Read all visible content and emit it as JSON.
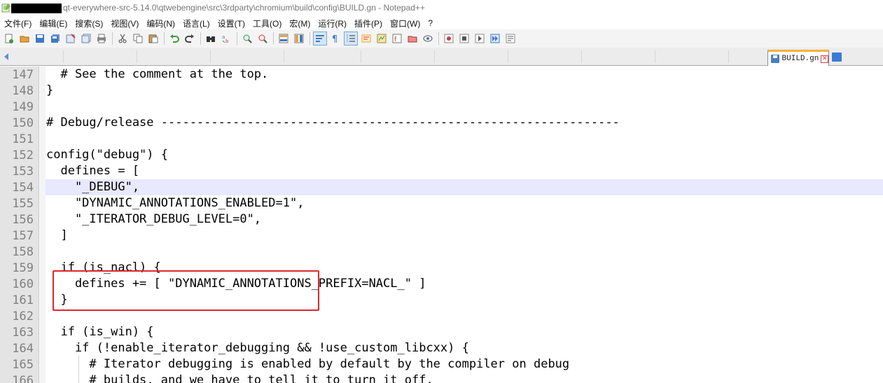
{
  "window": {
    "title": "qt-everywhere-src-5.14.0\\qtwebengine\\src\\3rdparty\\chromium\\build\\config\\BUILD.gn - Notepad++"
  },
  "menu": [
    "文件(F)",
    "编辑(E)",
    "搜索(S)",
    "视图(V)",
    "编码(N)",
    "语言(L)",
    "设置(T)",
    "工具(O)",
    "宏(M)",
    "运行(R)",
    "插件(P)",
    "窗口(W)",
    "?"
  ],
  "toolbar": {
    "icons": [
      "new-file-icon",
      "open-file-icon",
      "save-icon",
      "save-all-icon",
      "close-icon",
      "close-all-icon",
      "print-icon",
      "cut-icon",
      "copy-icon",
      "paste-icon",
      "undo-icon",
      "redo-icon",
      "find-icon",
      "replace-icon",
      "zoom-in-icon",
      "zoom-out-icon",
      "sync-vertical-icon",
      "sync-horizontal-icon",
      "word-wrap-icon",
      "show-all-chars-icon",
      "indent-guide-icon",
      "user-lang-icon",
      "doc-map-icon",
      "function-list-icon",
      "folder-workspace-icon",
      "monitor-icon",
      "record-macro-icon",
      "stop-record-icon",
      "play-macro-icon",
      "run-macro-multiple-icon",
      "save-macro-icon"
    ],
    "colors": {
      "blue": "#3f79c6",
      "orange": "#e9a13b",
      "green": "#3a9b3a",
      "red": "#d23a3a",
      "gray": "#8a8a8a"
    }
  },
  "tabs": [
    {
      "label": "BUILD.gn",
      "active": true
    }
  ],
  "editor": {
    "current_line": "154",
    "lines": [
      {
        "num": "147",
        "text": "  # See the comment at the top."
      },
      {
        "num": "148",
        "text": "}"
      },
      {
        "num": "149",
        "text": ""
      },
      {
        "num": "150",
        "text": "# Debug/release ----------------------------------------------------------------"
      },
      {
        "num": "151",
        "text": ""
      },
      {
        "num": "152",
        "text": "config(\"debug\") {"
      },
      {
        "num": "153",
        "text": "  defines = ["
      },
      {
        "num": "154",
        "text": "    \"_DEBUG\","
      },
      {
        "num": "155",
        "text": "    \"DYNAMIC_ANNOTATIONS_ENABLED=1\","
      },
      {
        "num": "156",
        "text": "    \"_ITERATOR_DEBUG_LEVEL=0\","
      },
      {
        "num": "157",
        "text": "  ]"
      },
      {
        "num": "158",
        "text": ""
      },
      {
        "num": "159",
        "text": "  if (is_nacl) {"
      },
      {
        "num": "160",
        "text": "    defines += [ \"DYNAMIC_ANNOTATIONS_PREFIX=NACL_\" ]"
      },
      {
        "num": "161",
        "text": "  }"
      },
      {
        "num": "162",
        "text": ""
      },
      {
        "num": "163",
        "text": "  if (is_win) {"
      },
      {
        "num": "164",
        "text": "    if (!enable_iterator_debugging && !use_custom_libcxx) {"
      },
      {
        "num": "165",
        "text": "      # Iterator debugging is enabled by default by the compiler on debug"
      },
      {
        "num": "166",
        "text": "      # builds, and we have to tell it to turn it off."
      }
    ]
  }
}
